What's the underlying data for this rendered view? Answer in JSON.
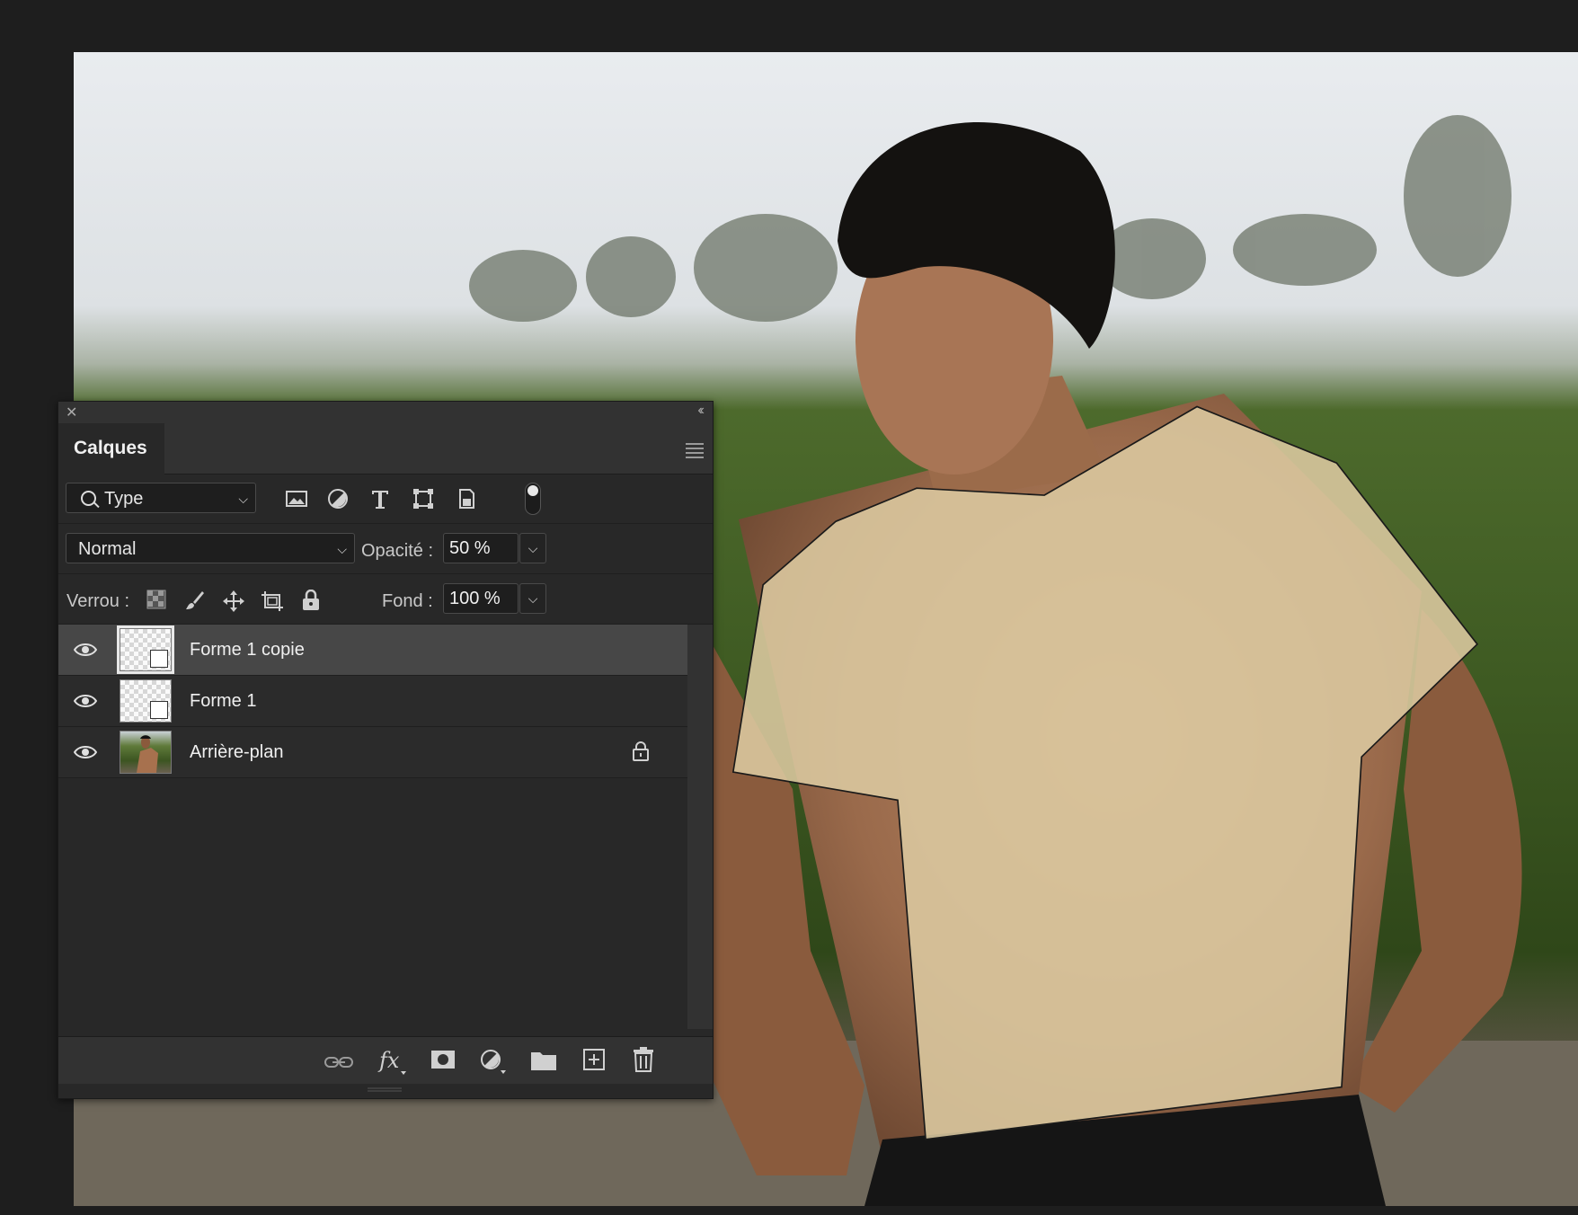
{
  "panel": {
    "tab_label": "Calques",
    "filter": {
      "value": "Type"
    },
    "blend_mode": "Normal",
    "opacity_label": "Opacité :",
    "opacity_value": "50 %",
    "lock_label": "Verrou :",
    "fill_label": "Fond :",
    "fill_value": "100 %",
    "layers": [
      {
        "name": "Forme 1 copie",
        "selected": true,
        "visible": true,
        "kind": "shape"
      },
      {
        "name": "Forme 1",
        "selected": false,
        "visible": true,
        "kind": "shape"
      },
      {
        "name": "Arrière-plan",
        "selected": false,
        "visible": true,
        "kind": "image",
        "locked": true
      }
    ]
  },
  "colors": {
    "app_bg": "#1e1e1e",
    "panel_bg": "#282828",
    "selected_row": "#474747",
    "shape_fill": "#dcc9a0"
  }
}
